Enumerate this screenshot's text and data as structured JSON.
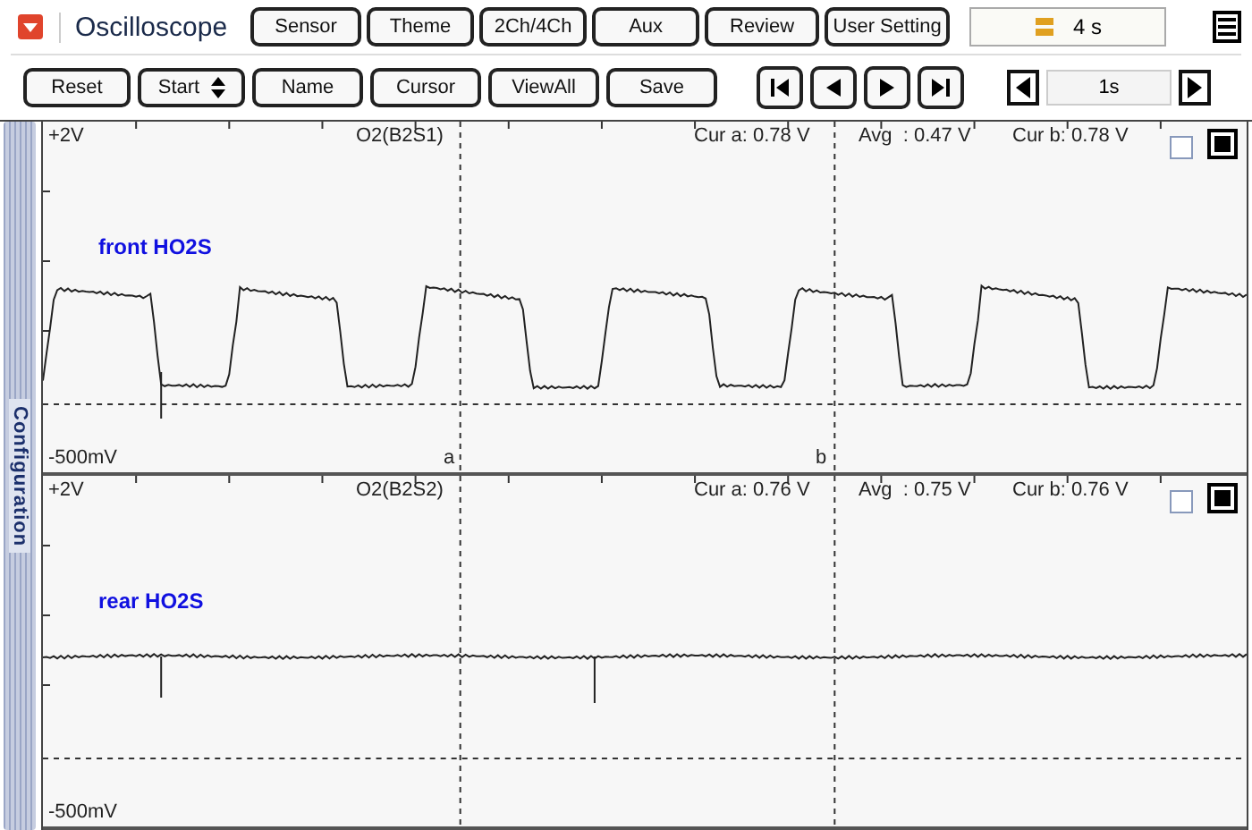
{
  "window": {
    "title": "Oscilloscope"
  },
  "top_buttons": [
    "Sensor",
    "Theme",
    "2Ch/4Ch",
    "Aux",
    "Review",
    "User Setting"
  ],
  "time_display": "4 s",
  "toolbar": {
    "buttons": [
      "Reset",
      "Name",
      "Cursor",
      "ViewAll",
      "Save"
    ],
    "start_select": "Start",
    "step": "1s"
  },
  "sidebar": {
    "label": "Configuration"
  },
  "channels": [
    {
      "top_label": "+2V",
      "bottom_label": "-500mV",
      "name": "O2(B2S1)",
      "cur_a": "Cur a: 0.78 V",
      "avg": "Avg  : 0.47 V",
      "cur_b": "Cur b: 0.78 V",
      "trace_label": "front HO2S",
      "kind": "square",
      "checked": false,
      "cursor_marks": [
        "a",
        "b"
      ]
    },
    {
      "top_label": "+2V",
      "bottom_label": "-500mV",
      "name": "O2(B2S2)",
      "cur_a": "Cur a: 0.76 V",
      "avg": "Avg  : 0.75 V",
      "cur_b": "Cur b: 0.76 V",
      "trace_label": "rear HO2S",
      "kind": "flat",
      "checked": false
    }
  ]
}
